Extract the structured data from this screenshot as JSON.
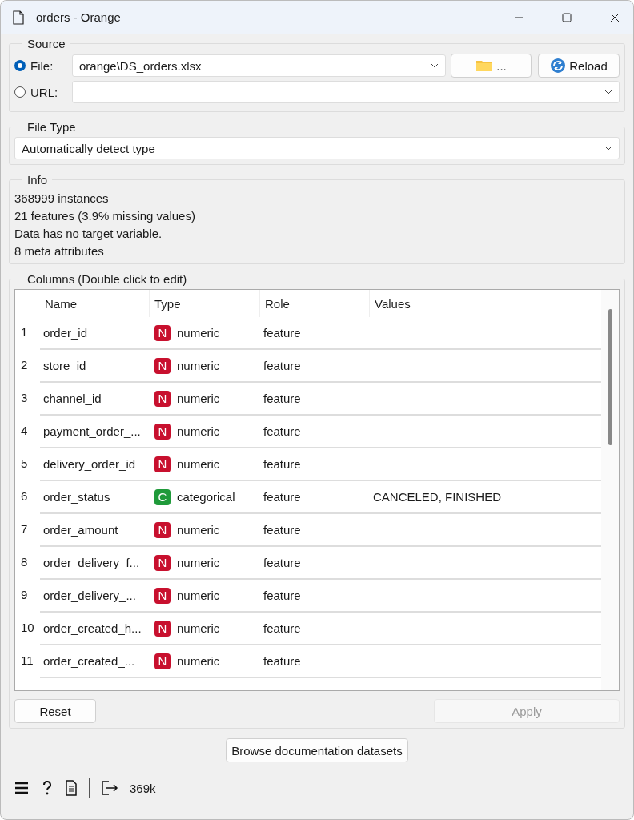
{
  "window": {
    "title": "orders - Orange"
  },
  "source": {
    "title": "Source",
    "options": [
      {
        "label": "File:",
        "selected": true,
        "kind": "combo",
        "value": "orange\\DS_orders.xlsx"
      },
      {
        "label": "URL:",
        "selected": false,
        "kind": "combo"
      }
    ],
    "browse_button": "...",
    "reload_button": "Reload"
  },
  "file_type": {
    "title": "File Type",
    "value": "Automatically detect type"
  },
  "info": {
    "title": "Info",
    "lines": [
      "368999 instances",
      "21 features (3.9% missing values)",
      "Data has no target variable.",
      "8 meta attributes"
    ]
  },
  "columns": {
    "title": "Columns (Double click to edit)",
    "headers": [
      "Name",
      "Type",
      "Role",
      "Values"
    ],
    "rows": [
      {
        "index": "1",
        "name": "order_id",
        "badge": "N",
        "color": "#c8102e",
        "type": "numeric",
        "role": "feature"
      },
      {
        "index": "2",
        "name": "store_id",
        "badge": "N",
        "color": "#c8102e",
        "type": "numeric",
        "role": "feature"
      },
      {
        "index": "3",
        "name": "channel_id",
        "badge": "N",
        "color": "#c8102e",
        "type": "numeric",
        "role": "feature"
      },
      {
        "index": "4",
        "name": "payment_order_...",
        "badge": "N",
        "color": "#c8102e",
        "type": "numeric",
        "role": "feature"
      },
      {
        "index": "5",
        "name": "delivery_order_id",
        "badge": "N",
        "color": "#c8102e",
        "type": "numeric",
        "role": "feature"
      },
      {
        "index": "6",
        "name": "order_status",
        "badge": "C",
        "color": "#1f9a3a",
        "type": "categorical",
        "role": "feature",
        "values": "CANCELED, FINISHED"
      },
      {
        "index": "7",
        "name": "order_amount",
        "badge": "N",
        "color": "#c8102e",
        "type": "numeric",
        "role": "feature"
      },
      {
        "index": "8",
        "name": "order_delivery_f...",
        "badge": "N",
        "color": "#c8102e",
        "type": "numeric",
        "role": "feature"
      },
      {
        "index": "9",
        "name": "order_delivery_...",
        "badge": "N",
        "color": "#c8102e",
        "type": "numeric",
        "role": "feature"
      },
      {
        "index": "10",
        "name": "order_created_h...",
        "badge": "N",
        "color": "#c8102e",
        "type": "numeric",
        "role": "feature"
      },
      {
        "index": "11",
        "name": "order_created_...",
        "badge": "N",
        "color": "#c8102e",
        "type": "numeric",
        "role": "feature"
      }
    ]
  },
  "buttons": [
    {
      "label": "Reset",
      "disabled": false
    },
    {
      "label": "Apply",
      "disabled": true
    }
  ],
  "browse_datasets_button": "Browse documentation datasets",
  "status_bar": {
    "output_count": "369k"
  }
}
